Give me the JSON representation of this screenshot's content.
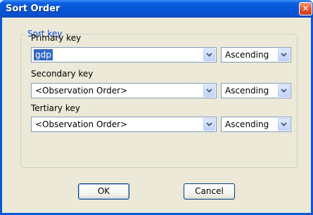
{
  "window": {
    "title": "Sort Order",
    "close_glyph": "✕"
  },
  "groupbox": {
    "legend": "Sort key"
  },
  "keys": [
    {
      "label": "Primary key",
      "field": "gdp",
      "order": "Ascending"
    },
    {
      "label": "Secondary key",
      "field": "<Observation Order>",
      "order": "Ascending"
    },
    {
      "label": "Tertiary key",
      "field": "<Observation Order>",
      "order": "Ascending"
    }
  ],
  "buttons": {
    "ok": "OK",
    "cancel": "Cancel"
  },
  "icons": {
    "close": "close-icon",
    "dropdown": "chevron-down-icon"
  },
  "colors": {
    "titlebar": "#0554d6",
    "selection": "#316ac5",
    "legend": "#0046d5",
    "dialog_bg": "#ece9d8"
  }
}
